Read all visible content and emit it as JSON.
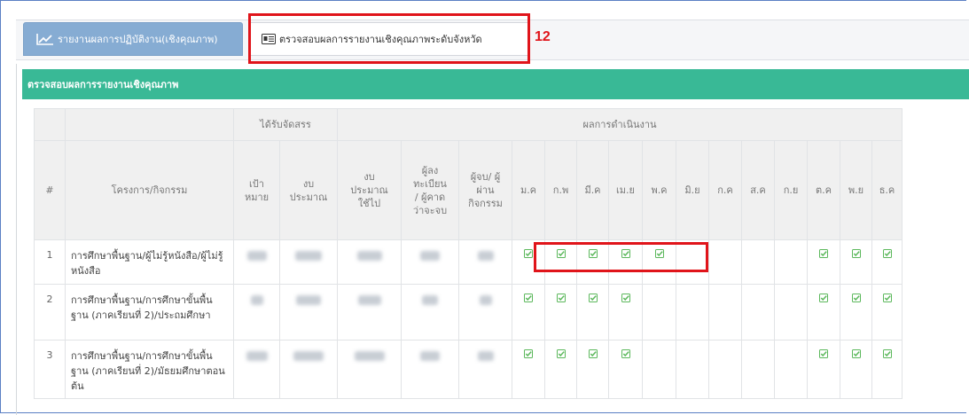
{
  "tabs": [
    {
      "label": "รายงานผลการปฏิบัติงาน(เชิงคุณภาพ)",
      "icon": "line-chart-icon",
      "active": true
    },
    {
      "label": "ตรวจสอบผลการรายงานเชิงคุณภาพระดับจังหวัด",
      "icon": "id-card-icon",
      "active": false
    }
  ],
  "annotation_number": "12",
  "panel": {
    "title": "ตรวจสอบผลการรายงานเชิงคุณภาพ"
  },
  "table": {
    "group_headers": {
      "allocated": "ได้รับจัดสรร",
      "results": "ผลการดำเนินงาน"
    },
    "col_index": "#",
    "col_project": "โครงการ/กิจกรรม",
    "col_target": "เป้า หมาย",
    "col_budget": "งบ ประมาณ",
    "col_budget_used": "งบ ประมาณ ใช้ไป",
    "col_registered": "ผู้ลง ทะเบียน / ผู้คาด ว่าจะจบ",
    "col_graduated": "ผู้จบ/ ผู้ผ่าน กิจกรรม",
    "months": [
      "ม.ค",
      "ก.พ",
      "มี.ค",
      "เม.ย",
      "พ.ค",
      "มิ.ย",
      "ก.ค",
      "ส.ค",
      "ก.ย",
      "ต.ค",
      "พ.ย",
      "ธ.ค"
    ],
    "rows": [
      {
        "index": "1",
        "project": "การศึกษาพื้นฐาน/ผู้ไม่รู้หนังสือ/ผู้ไม่รู้หนังสือ",
        "checks": [
          true,
          true,
          true,
          true,
          true,
          false,
          false,
          false,
          false,
          true,
          true,
          true
        ]
      },
      {
        "index": "2",
        "project": "การศึกษาพื้นฐาน/การศึกษาขั้นพื้นฐาน (ภาคเรียนที่ 2)/ประถมศึกษา",
        "checks": [
          true,
          true,
          true,
          true,
          false,
          false,
          false,
          false,
          false,
          true,
          true,
          true
        ]
      },
      {
        "index": "3",
        "project": "การศึกษาพื้นฐาน/การศึกษาขั้นพื้นฐาน (ภาคเรียนที่ 2)/มัธยมศึกษาตอนต้น",
        "checks": [
          true,
          true,
          true,
          true,
          false,
          false,
          false,
          false,
          false,
          true,
          true,
          true
        ]
      }
    ]
  },
  "colors": {
    "tab_active": "#86acd3",
    "panel_header": "#39b996",
    "check": "#5cb85c",
    "highlight": "#e0141a"
  }
}
